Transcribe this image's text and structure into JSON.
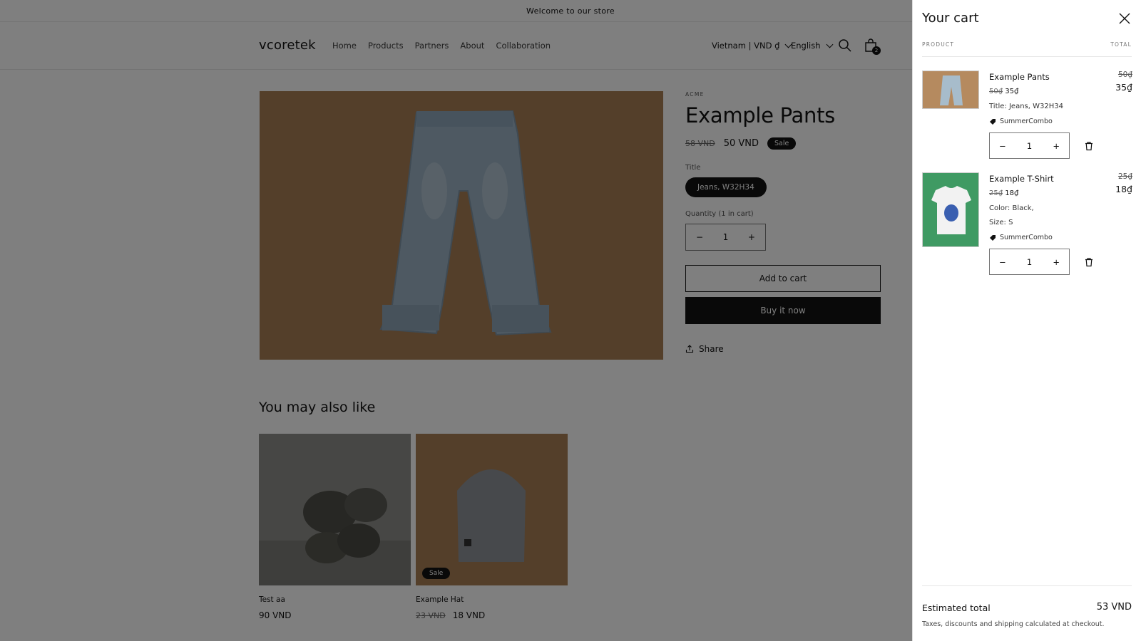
{
  "announcement": "Welcome to our store",
  "header": {
    "logo": "vcoretek",
    "nav": [
      "Home",
      "Products",
      "Partners",
      "About",
      "Collaboration"
    ],
    "country": "Vietnam | VND ₫",
    "language": "English",
    "cart_count": "2"
  },
  "product": {
    "vendor": "ACME",
    "title": "Example Pants",
    "compare_price": "58 VND",
    "price": "50 VND",
    "sale_badge": "Sale",
    "option_label": "Title",
    "option_value": "Jeans, W32H34",
    "quantity_label": "Quantity (1 in cart)",
    "quantity": "1",
    "add_to_cart": "Add to cart",
    "buy_now": "Buy it now",
    "share": "Share"
  },
  "recommendations": {
    "title": "You may also like",
    "items": [
      {
        "title": "Test aa",
        "price": "90 VND",
        "compare_price": ""
      },
      {
        "title": "Example Hat",
        "price": "18 VND",
        "compare_price": "23 VND",
        "badge": "Sale"
      }
    ]
  },
  "cart": {
    "title": "Your cart",
    "col_product": "PRODUCT",
    "col_total": "TOTAL",
    "items": [
      {
        "name": "Example Pants",
        "price_old": "50₫",
        "price": "35₫",
        "options": [
          "Title: Jeans, W32H34"
        ],
        "discount": "SummerCombo",
        "quantity": "1",
        "total_old": "50₫",
        "total": "35₫"
      },
      {
        "name": "Example T-Shirt",
        "price_old": "25₫",
        "price": "18₫",
        "options": [
          "Color: Black,",
          "Size: S"
        ],
        "discount": "SummerCombo",
        "quantity": "1",
        "total_old": "25₫",
        "total": "18₫"
      }
    ],
    "estimated_label": "Estimated total",
    "estimated_value": "53 VND",
    "tax_note": "Taxes, discounts and shipping calculated at checkout."
  },
  "colors": {
    "text": "#121212",
    "overlay": "rgba(0,0,0,0.5)",
    "thumb_green": "#3f9a63",
    "thumb_brown": "#a87f55"
  }
}
